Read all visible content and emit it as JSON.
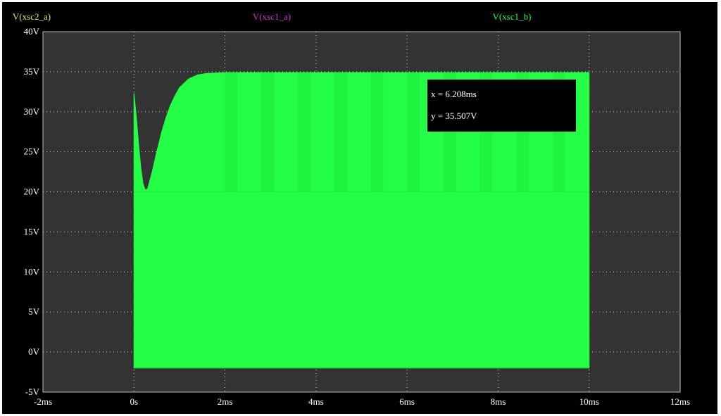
{
  "chart_data": {
    "type": "line",
    "x_unit": "ms",
    "y_unit": "V",
    "xlim": [
      -2,
      12
    ],
    "ylim": [
      -5,
      40
    ],
    "x_ticks": [
      -2,
      0,
      2,
      4,
      6,
      8,
      10,
      12
    ],
    "y_ticks": [
      -5,
      0,
      5,
      10,
      15,
      20,
      25,
      30,
      35,
      40
    ],
    "x_tick_labels": [
      "-2ms",
      "0s",
      "2ms",
      "4ms",
      "6ms",
      "8ms",
      "10ms",
      "12ms"
    ],
    "y_tick_labels": [
      "-5V",
      "0V",
      "5V",
      "10V",
      "15V",
      "20V",
      "25V",
      "30V",
      "35V",
      "40V"
    ],
    "grid": true,
    "background": "#333333",
    "series": [
      {
        "name": "V(xsc2_a)",
        "color": "#e8e84a",
        "visible": false,
        "points": []
      },
      {
        "name": "V(xsc1_a)",
        "color": "#cc33cc",
        "visible": false,
        "points": []
      },
      {
        "name": "V(xsc1_b)",
        "color": "#22ff44",
        "visible": true,
        "fill_low": -2.0,
        "envelope_top": [
          [
            0,
            32.3
          ],
          [
            0.05,
            29.5
          ],
          [
            0.1,
            26
          ],
          [
            0.15,
            23
          ],
          [
            0.2,
            21
          ],
          [
            0.25,
            20.2
          ],
          [
            0.3,
            20.4
          ],
          [
            0.4,
            22.5
          ],
          [
            0.5,
            25
          ],
          [
            0.6,
            27.3
          ],
          [
            0.7,
            29.2
          ],
          [
            0.8,
            30.8
          ],
          [
            0.9,
            32
          ],
          [
            1.0,
            33
          ],
          [
            1.2,
            34.1
          ],
          [
            1.4,
            34.6
          ],
          [
            1.6,
            34.8
          ],
          [
            1.8,
            34.85
          ],
          [
            2.0,
            34.9
          ],
          [
            3,
            34.9
          ],
          [
            4,
            34.9
          ],
          [
            5,
            34.9
          ],
          [
            6,
            34.9
          ],
          [
            7,
            34.9
          ],
          [
            8,
            34.9
          ],
          [
            9,
            34.9
          ],
          [
            10,
            34.9
          ]
        ]
      }
    ]
  },
  "cursor": {
    "x_text": "x = 6.208ms",
    "y_text": "y = 35.507V"
  }
}
